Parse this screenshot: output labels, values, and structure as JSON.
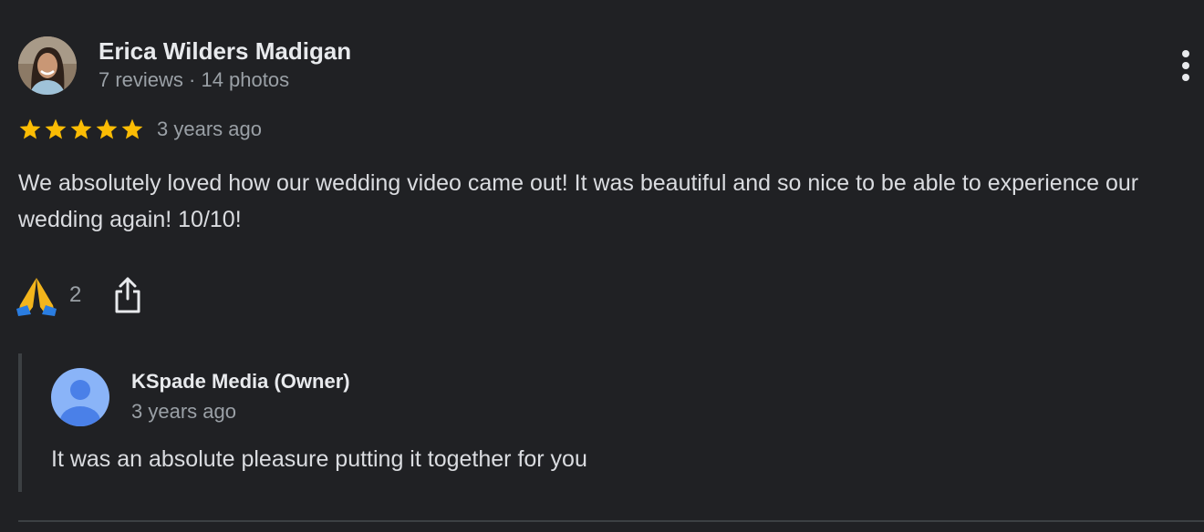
{
  "review": {
    "reviewer_name": "Erica Wilders Madigan",
    "reviewer_meta": "7 reviews · 14 photos",
    "rating": 5,
    "rating_max": 5,
    "time": "3 years ago",
    "text": "We absolutely loved how our wedding video came out! It was beautiful and so nice to be able to experience our wedding again! 10/10!",
    "reaction_icon": "folded-hands-emoji",
    "reaction_count": "2"
  },
  "reply": {
    "owner_name": "KSpade Media (Owner)",
    "time": "3 years ago",
    "text": "It was an absolute pleasure putting it together for you"
  },
  "colors": {
    "background": "#202124",
    "star": "#fbbc04",
    "owner_avatar_bg": "#8ab4f8",
    "owner_avatar_fg": "#4a80e8"
  }
}
